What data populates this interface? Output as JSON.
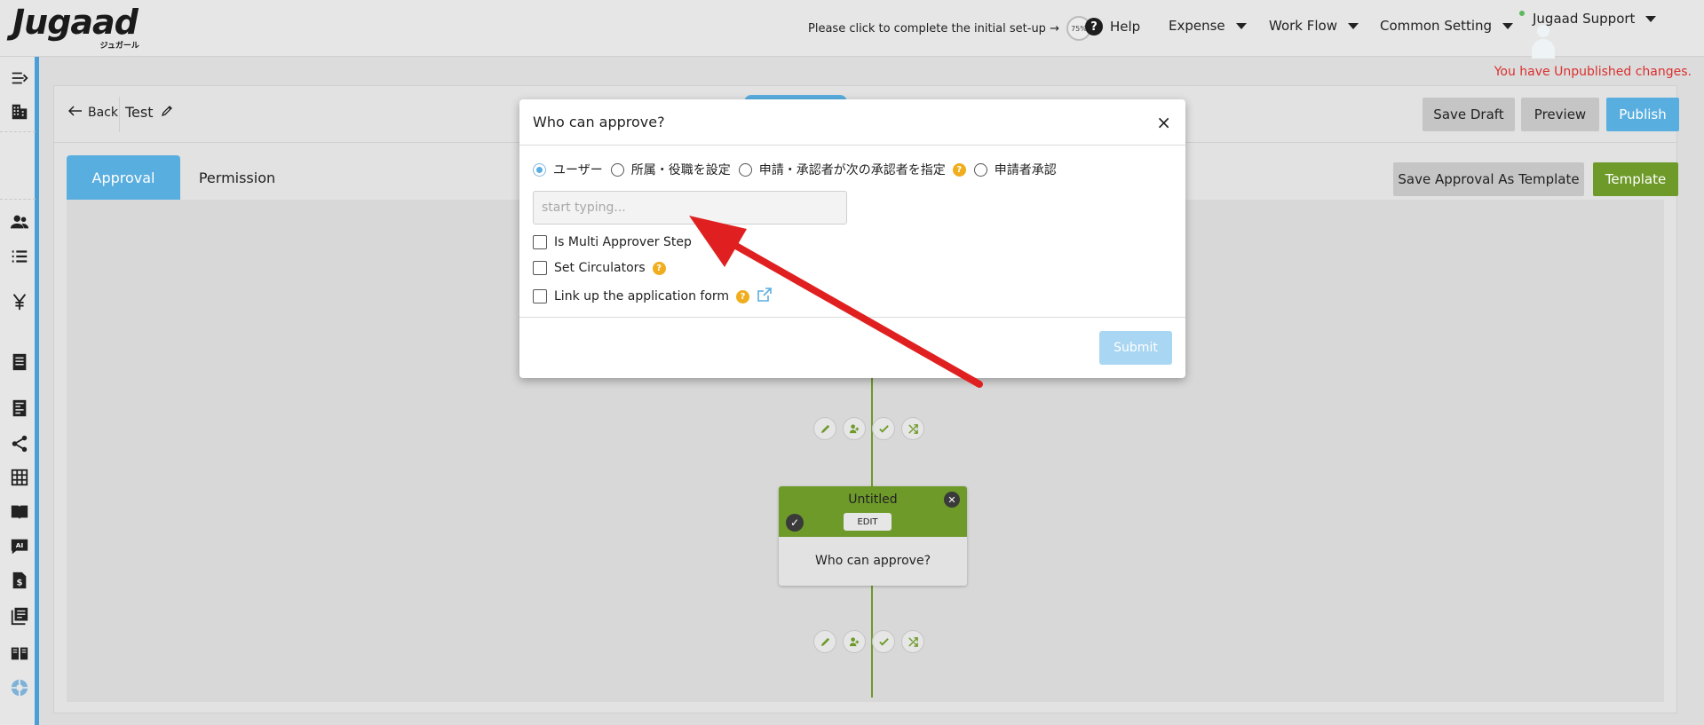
{
  "header": {
    "logo_text": "Jugaad",
    "logo_kana": "ジュガール",
    "setup_text": "Please click to complete the initial set-up →",
    "setup_progress": "75%",
    "help_label": "Help",
    "menu_expense": "Expense",
    "menu_workflow": "Work Flow",
    "menu_common": "Common Setting",
    "user_name": "Jugaad Support"
  },
  "notice": "You have Unpublished changes.",
  "page": {
    "back_label": "Back",
    "title": "Test",
    "save_draft": "Save Draft",
    "preview": "Preview",
    "publish": "Publish",
    "tab_approval": "Approval",
    "tab_permission": "Permission",
    "save_as_template": "Save Approval As Template",
    "template": "Template"
  },
  "node": {
    "title": "Untitled",
    "edit_label": "EDIT",
    "subtitle": "Who can approve?"
  },
  "modal": {
    "title": "Who can approve?",
    "radio_user": "ユーザー",
    "radio_dept": "所属・役職を設定",
    "radio_next": "申請・承認者が次の承認者を指定",
    "radio_applicant": "申請者承認",
    "input_placeholder": "start typing...",
    "check_multi": "Is Multi Approver Step",
    "check_circulators": "Set Circulators",
    "check_link": "Link up the application form",
    "submit": "Submit"
  },
  "colors": {
    "accent_blue": "#59aee0",
    "accent_green": "#6e9a2a",
    "warning_red": "#d9302f",
    "arrow_red": "#e02020"
  }
}
